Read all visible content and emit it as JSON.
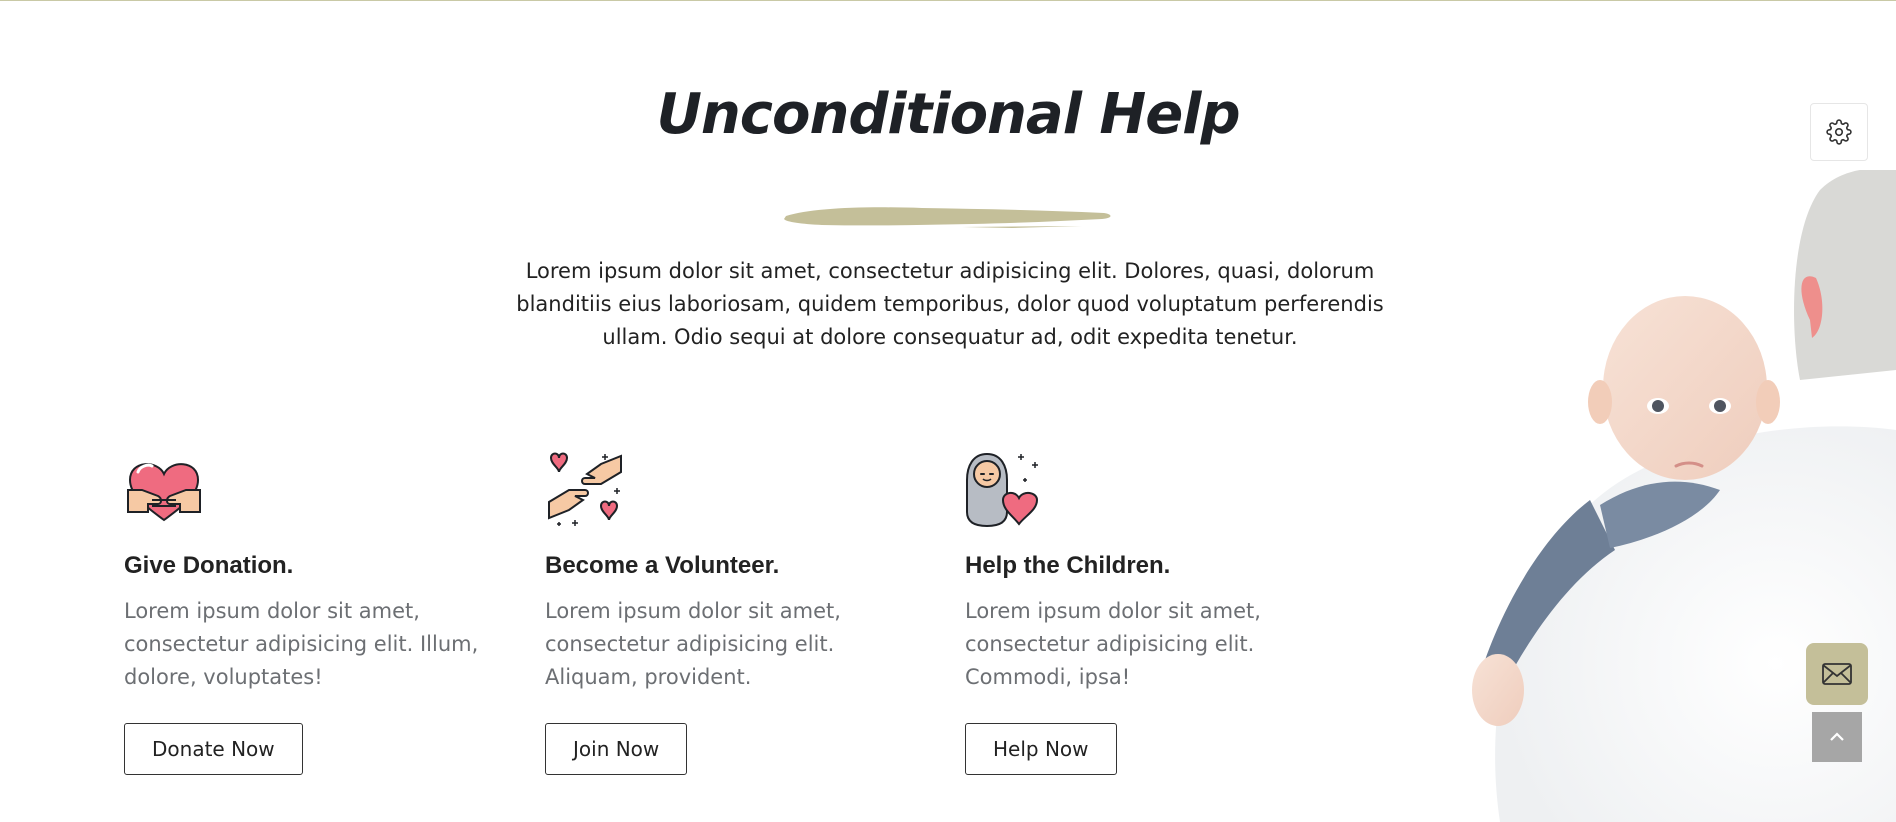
{
  "section": {
    "title": "Unconditional Help",
    "intro": "Lorem ipsum dolor sit amet, consectetur adipisicing elit. Dolores, quasi, dolorum blanditiis eius laboriosam, quidem temporibus, dolor quod voluptatum perferendis ullam. Odio sequi at dolore consequatur ad, odit expedita tenetur."
  },
  "cards": [
    {
      "icon": "heart-hands-icon",
      "heading": "Give Donation.",
      "text": "Lorem ipsum dolor sit amet, consectetur adipisicing elit. Illum, dolore, voluptates!",
      "button": "Donate Now"
    },
    {
      "icon": "helping-hands-icon",
      "heading": "Become a Volunteer.",
      "text": "Lorem ipsum dolor sit amet, consectetur adipisicing elit. Aliquam, provident.",
      "button": "Join Now"
    },
    {
      "icon": "baby-heart-icon",
      "heading": "Help the Children.",
      "text": "Lorem ipsum dolor sit amet, consectetur adipisicing elit. Commodi, ipsa!",
      "button": "Help Now"
    }
  ],
  "floating": {
    "settings_icon": "gear-icon",
    "mail_icon": "envelope-icon",
    "top_icon": "chevron-up-icon"
  },
  "colors": {
    "accent": "#c4bf99",
    "heart": "#ef6b80",
    "text": "#222222",
    "muted": "#6c6f73"
  }
}
